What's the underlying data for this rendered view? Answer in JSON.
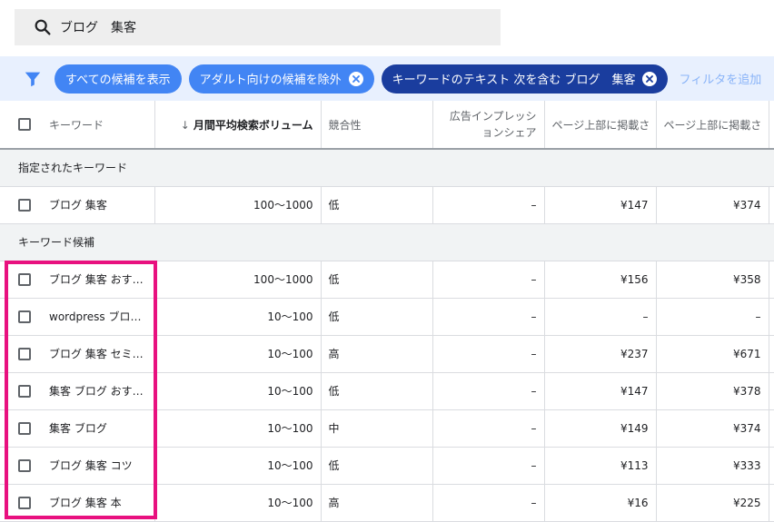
{
  "search": {
    "query": "ブログ　集客"
  },
  "filters": {
    "chips": [
      {
        "label": "すべての候補を表示",
        "style": "light",
        "removable": false
      },
      {
        "label": "アダルト向けの候補を除外",
        "style": "light",
        "removable": true
      },
      {
        "label": "キーワードのテキスト 次を含む ブログ　集客",
        "style": "dark",
        "removable": true
      }
    ],
    "add_label": "フィルタを追加"
  },
  "table": {
    "headers": {
      "keyword": "キーワード",
      "volume": "月間平均検索ボリューム",
      "competition": "競合性",
      "impression_share": "広告インプレッションシェア",
      "top_bid_low": "ページ上部に掲載さ",
      "top_bid_high": "ページ上部に掲載さ"
    },
    "section_specified": "指定されたキーワード",
    "specified_rows": [
      {
        "keyword": "ブログ 集客",
        "volume": "100～1000",
        "competition": "低",
        "share": "–",
        "low": "¥147",
        "high": "¥374"
      }
    ],
    "section_ideas": "キーワード候補",
    "idea_rows": [
      {
        "keyword": "ブログ 集客 おすすめ",
        "volume": "100～1000",
        "competition": "低",
        "share": "–",
        "low": "¥156",
        "high": "¥358"
      },
      {
        "keyword": "wordpress ブログ 集客",
        "volume": "10～100",
        "competition": "低",
        "share": "–",
        "low": "–",
        "high": "–"
      },
      {
        "keyword": "ブログ 集客 セミナー",
        "volume": "10～100",
        "competition": "高",
        "share": "–",
        "low": "¥237",
        "high": "¥671"
      },
      {
        "keyword": "集客 ブログ おすすめ",
        "volume": "10～100",
        "competition": "低",
        "share": "–",
        "low": "¥147",
        "high": "¥378"
      },
      {
        "keyword": "集客 ブログ",
        "volume": "10～100",
        "competition": "中",
        "share": "–",
        "low": "¥149",
        "high": "¥374"
      },
      {
        "keyword": "ブログ 集客 コツ",
        "volume": "10～100",
        "competition": "低",
        "share": "–",
        "low": "¥113",
        "high": "¥333"
      },
      {
        "keyword": "ブログ 集客 本",
        "volume": "10～100",
        "competition": "高",
        "share": "–",
        "low": "¥16",
        "high": "¥225"
      }
    ]
  },
  "colors": {
    "accent": "#4285f4",
    "chip_dark": "#1a3d9e",
    "highlight": "#e8117f"
  }
}
